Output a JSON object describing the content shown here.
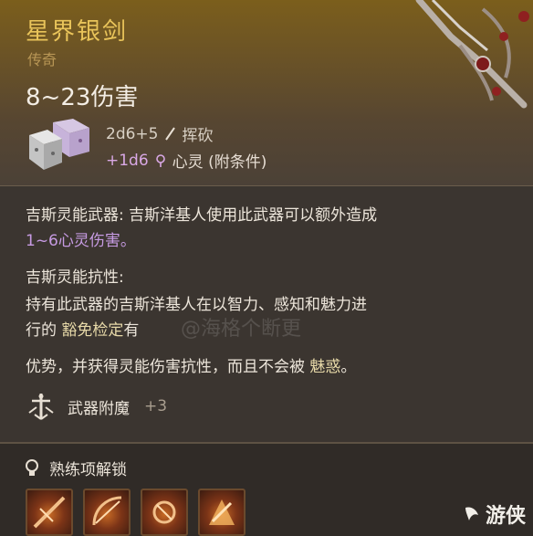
{
  "item": {
    "name": "星界银剑",
    "rarity": "传奇",
    "damage_range": "8~23伤害",
    "damage_line1": {
      "dice": "2d6+5",
      "type": "挥砍"
    },
    "damage_line2": {
      "dice": "+1d6",
      "type": "心灵 (附条件)"
    }
  },
  "properties": {
    "p1_label": "吉斯灵能武器:",
    "p1_text": " 吉斯洋基人使用此武器可以额外造成",
    "p1_line2": "1~6心灵伤害。",
    "p2_label": "吉斯灵能抗性:",
    "p2_line1": "持有此武器的吉斯洋基人在以智力、感知和魅力进",
    "p2_line2_a": "行的 ",
    "p2_line2_b": "豁免检定",
    "p2_line2_c": "有",
    "p2_line3_a": "优势，并获得灵能伤害抗性，而且不会被 ",
    "p2_line3_b": "魅惑",
    "p2_line3_c": "。"
  },
  "watermark": "@海格个断更",
  "enchantment": {
    "label": "武器附魔",
    "value": "+3"
  },
  "proficiency": {
    "label": "熟练项解锁"
  },
  "skills": [
    "slash-skill-icon",
    "bow-skill-icon",
    "pommel-skill-icon",
    "rush-skill-icon"
  ],
  "site_mark": "游侠",
  "colors": {
    "title": "#e9c45a",
    "psychic": "#d9a8e5",
    "header_top": "#7b5e1c"
  }
}
